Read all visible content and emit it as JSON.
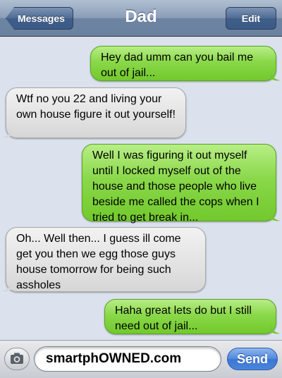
{
  "nav": {
    "title": "Dad",
    "back_label": "Messages",
    "edit_label": "Edit"
  },
  "messages": [
    {
      "from": "me",
      "text": "Hey dad umm can you bail me out of jail..."
    },
    {
      "from": "dad",
      "text": "Wtf no you 22 and living your own house figure it out yourself!"
    },
    {
      "from": "me",
      "text": "Well I was figuring it out myself until I locked myself out of the house and those people who live beside me called the cops when I tried to get break in..."
    },
    {
      "from": "dad",
      "text": "Oh... Well then... I guess ill come get you then we egg those guys house tomorrow for being such assholes"
    },
    {
      "from": "me",
      "text": "Haha great lets do but I still need out of jail..."
    }
  ],
  "input": {
    "value": "smartphOWNED.com",
    "send_label": "Send"
  },
  "colors": {
    "outgoing_bubble": "#8ad84a",
    "incoming_bubble": "#e2e2e2",
    "nav_bar": "#6d84a2",
    "send_button": "#4e87de"
  }
}
